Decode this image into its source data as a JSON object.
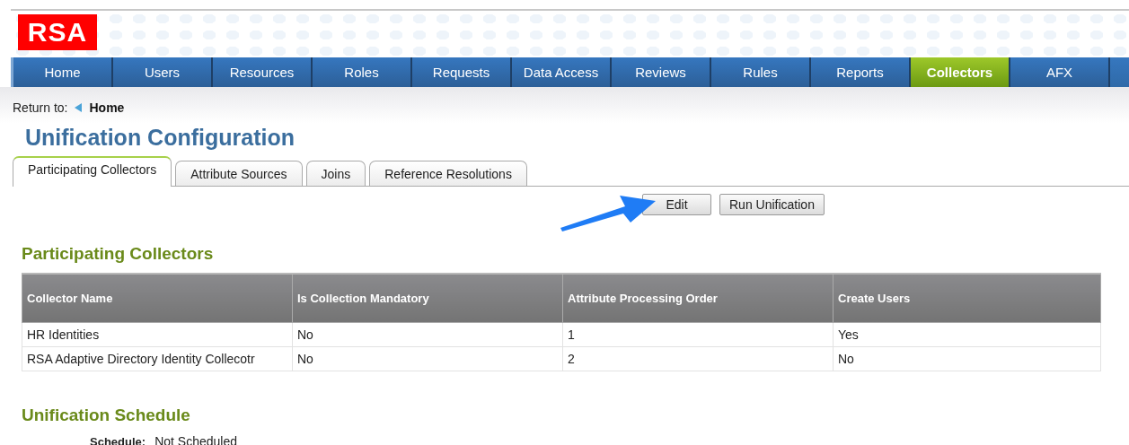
{
  "logo": {
    "text": "RSA"
  },
  "nav": [
    {
      "label": "Home",
      "selected": false
    },
    {
      "label": "Users",
      "selected": false
    },
    {
      "label": "Resources",
      "selected": false
    },
    {
      "label": "Roles",
      "selected": false
    },
    {
      "label": "Requests",
      "selected": false
    },
    {
      "label": "Data Access",
      "selected": false
    },
    {
      "label": "Reviews",
      "selected": false
    },
    {
      "label": "Rules",
      "selected": false
    },
    {
      "label": "Reports",
      "selected": false
    },
    {
      "label": "Collectors",
      "selected": true
    },
    {
      "label": "AFX",
      "selected": false
    }
  ],
  "breadcrumb": {
    "label": "Return to:",
    "link": "Home"
  },
  "title": "Unification Configuration",
  "tabs": [
    {
      "label": "Participating Collectors",
      "selected": true
    },
    {
      "label": "Attribute Sources",
      "selected": false
    },
    {
      "label": "Joins",
      "selected": false
    },
    {
      "label": "Reference Resolutions",
      "selected": false
    }
  ],
  "buttons": [
    "Edit",
    "Run Unification"
  ],
  "collectors": {
    "heading": "Participating Collectors",
    "columns": [
      "Collector Name",
      "Is Collection Mandatory",
      "Attribute Processing Order",
      "Create Users"
    ],
    "rows": [
      [
        "HR Identities",
        "No",
        "1",
        "Yes"
      ],
      [
        "RSA Adaptive Directory Identity Collecotr",
        "No",
        "2",
        "No"
      ]
    ]
  },
  "schedule": {
    "heading": "Unification Schedule",
    "label": "Schedule:",
    "value": "Not Scheduled"
  }
}
